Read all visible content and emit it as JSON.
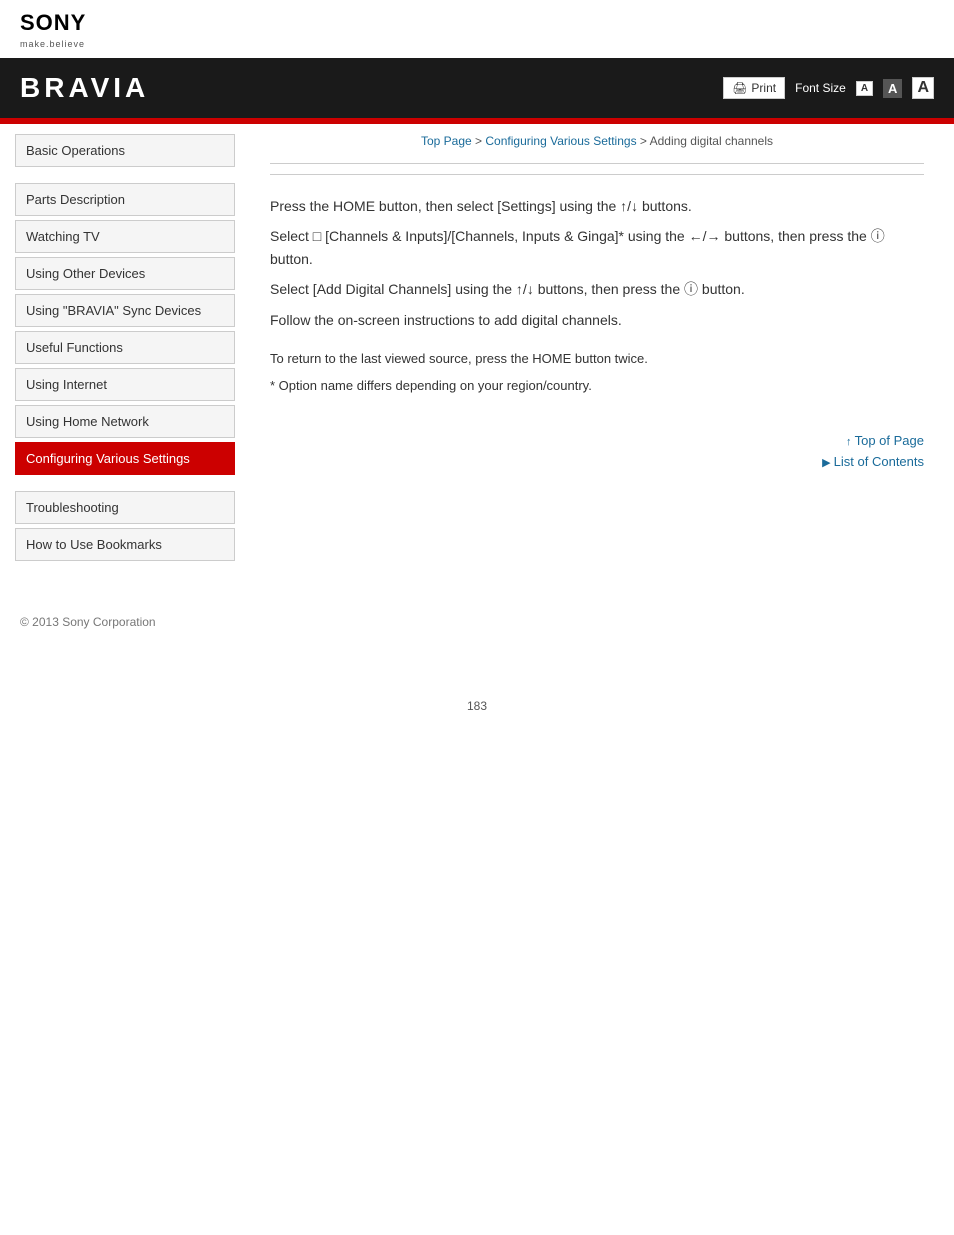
{
  "sony": {
    "logo": "SONY",
    "tagline": "make.believe"
  },
  "header": {
    "title": "BRAVIA",
    "print_label": "Print",
    "font_size_label": "Font Size",
    "font_small": "A",
    "font_medium": "A",
    "font_large": "A"
  },
  "breadcrumb": {
    "top_page": "Top Page",
    "separator1": " > ",
    "configuring": "Configuring Various Settings",
    "separator2": " > ",
    "current": "Adding digital channels"
  },
  "sidebar": {
    "items": [
      {
        "id": "basic-operations",
        "label": "Basic Operations",
        "active": false
      },
      {
        "id": "parts-description",
        "label": "Parts Description",
        "active": false
      },
      {
        "id": "watching-tv",
        "label": "Watching TV",
        "active": false
      },
      {
        "id": "using-other-devices",
        "label": "Using Other Devices",
        "active": false
      },
      {
        "id": "using-bravia-sync",
        "label": "Using \"BRAVIA\" Sync Devices",
        "active": false
      },
      {
        "id": "useful-functions",
        "label": "Useful Functions",
        "active": false
      },
      {
        "id": "using-internet",
        "label": "Using Internet",
        "active": false
      },
      {
        "id": "using-home-network",
        "label": "Using Home Network",
        "active": false
      },
      {
        "id": "configuring-settings",
        "label": "Configuring Various Settings",
        "active": true
      },
      {
        "id": "troubleshooting",
        "label": "Troubleshooting",
        "active": false
      },
      {
        "id": "how-to-use-bookmarks",
        "label": "How to Use Bookmarks",
        "active": false
      }
    ]
  },
  "article": {
    "step1": "Press the HOME button, then select [Settings] using the ↑/↓ buttons.",
    "step2": "Select □ [Channels & Inputs]/[Channels, Inputs & Ginga]* using the ←/→ buttons, then press the ⓘ button.",
    "step3": "Select [Add Digital Channels] using the ↑/↓ buttons, then press the ⓘ button.",
    "step4": "Follow the on-screen instructions to add digital channels.",
    "return_note": "To return to the last viewed source, press the HOME button twice.",
    "option_note": "* Option name differs depending on your region/country."
  },
  "footer_links": {
    "top_of_page": "Top of Page",
    "list_of_contents": "List of Contents"
  },
  "page_footer": {
    "copyright": "© 2013 Sony Corporation",
    "page_number": "183"
  }
}
